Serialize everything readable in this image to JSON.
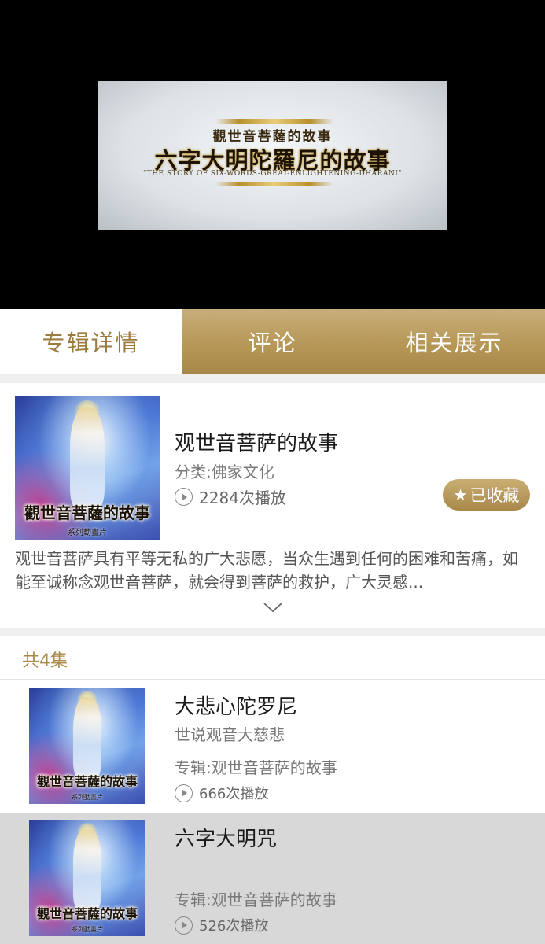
{
  "video": {
    "subtitle": "觀世音菩薩的故事",
    "title": "六字大明陀羅尼的故事",
    "english": "\"THE STORY OF SIX-WORDS-GREAT-ENLIGHTENING-DHARANI\""
  },
  "tabs": [
    {
      "label": "专辑详情",
      "active": true
    },
    {
      "label": "评论",
      "active": false
    },
    {
      "label": "相关展示",
      "active": false
    }
  ],
  "album": {
    "cover_title": "觀世音菩薩的故事",
    "cover_subtitle": "系列動畫片",
    "title": "观世音菩萨的故事",
    "category": "分类:佛家文化",
    "plays": "2284次播放",
    "favorite_label": "已收藏",
    "description": "观世音菩萨具有平等无私的广大悲愿，当众生遇到任何的困难和苦痛，如能至诚称念观世音菩萨，就会得到菩萨的救护，广大灵感..."
  },
  "episode_count": "共4集",
  "episodes": [
    {
      "title": "大悲心陀罗尼",
      "desc": "世说观音大慈悲",
      "album": "专辑:观世音菩萨的故事",
      "plays": "666次播放",
      "selected": false
    },
    {
      "title": "六字大明咒",
      "desc": "",
      "album": "专辑:观世音菩萨的故事",
      "plays": "526次播放",
      "selected": true
    }
  ],
  "colors": {
    "accent_gold": "#a88848",
    "tab_active_text": "#9b7b3e",
    "selected_row": "#d8d8d8"
  }
}
